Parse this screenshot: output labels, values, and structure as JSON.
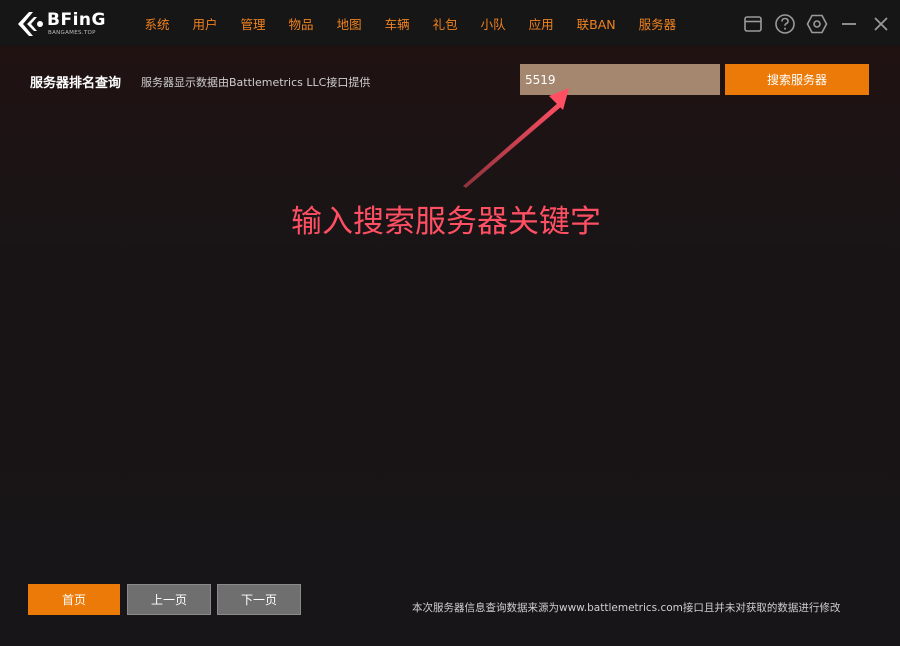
{
  "app": {
    "logo_text": "BFinG",
    "logo_sub": "BANGAMES.TOP"
  },
  "nav": {
    "items": [
      {
        "label": "系统"
      },
      {
        "label": "用户"
      },
      {
        "label": "管理"
      },
      {
        "label": "物品"
      },
      {
        "label": "地图"
      },
      {
        "label": "车辆"
      },
      {
        "label": "礼包"
      },
      {
        "label": "小队"
      },
      {
        "label": "应用"
      },
      {
        "label": "联BAN"
      },
      {
        "label": "服务器"
      }
    ]
  },
  "window_controls": [
    "window-icon",
    "help-icon",
    "settings-icon",
    "minimize-icon",
    "close-icon"
  ],
  "header": {
    "title": "服务器排名查询",
    "subtitle": "服务器显示数据由Battlemetrics  LLC接口提供"
  },
  "search": {
    "value": "5519",
    "button_label": "搜索服务器"
  },
  "annotation": {
    "text": "输入搜索服务器关键字"
  },
  "pagination": {
    "first_label": "首页",
    "prev_label": "上一页",
    "next_label": "下一页"
  },
  "footer": {
    "note": "本次服务器信息查询数据来源为www.battlemetrics.com接口且并未对获取的数据进行修改"
  },
  "colors": {
    "accent": "#ec7a09",
    "nav_text": "#f0821e",
    "input_bg": "#a5876f",
    "annotation": "#ff4f63",
    "secondary_button": "#6f6f6f"
  }
}
